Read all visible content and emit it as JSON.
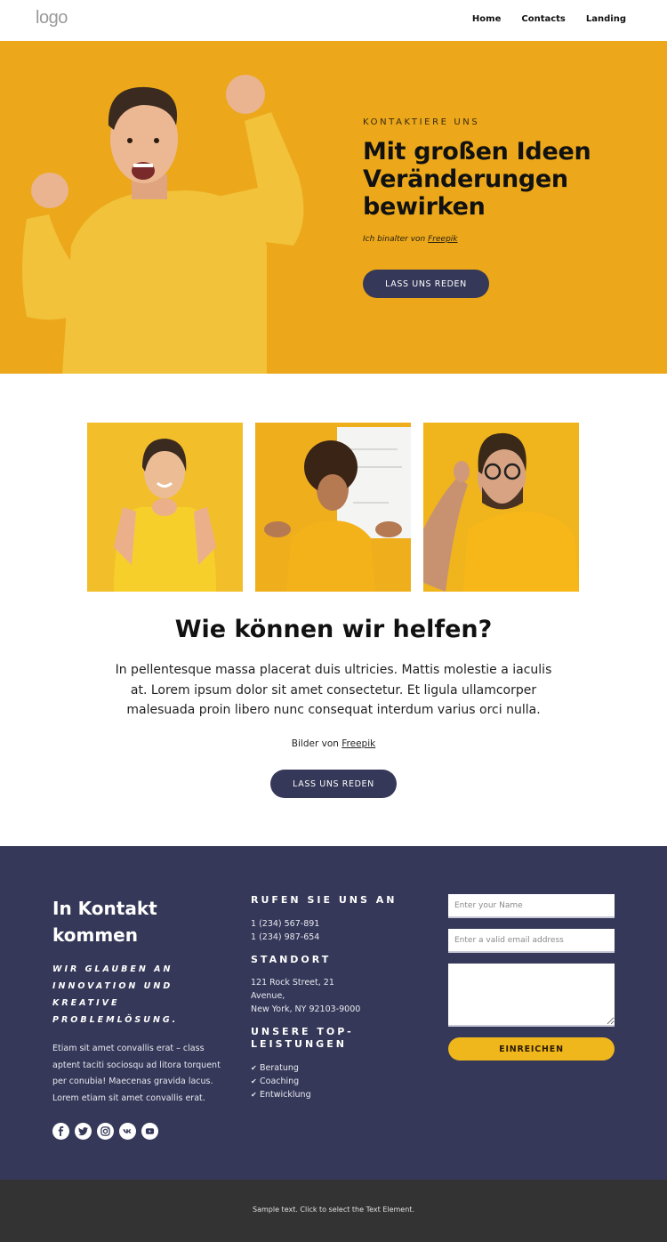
{
  "header": {
    "logo": "logo",
    "nav": [
      {
        "label": "Home"
      },
      {
        "label": "Contacts"
      },
      {
        "label": "Landing"
      }
    ]
  },
  "hero": {
    "kicker": "KONTAKTIERE UNS",
    "title": "Mit großen Ideen Veränderungen bewirken",
    "credit_prefix": "Ich binalter von ",
    "credit_link": "Freepik",
    "button": "LASS UNS REDEN",
    "image": "excited-man-yellow-sweater",
    "colors": {
      "background": "#eca81a",
      "button": "#353858"
    }
  },
  "gallery": {
    "images": [
      {
        "alt": "smiling-woman-yellow-tshirt"
      },
      {
        "alt": "woman-shrugging-yellow-shirt"
      },
      {
        "alt": "surprised-man-glasses"
      }
    ]
  },
  "help": {
    "title": "Wie können wir helfen?",
    "body": "In pellentesque massa placerat duis ultricies. Mattis molestie a iaculis at. Lorem ipsum dolor sit amet consectetur. Et ligula ullamcorper malesuada proin libero nunc consequat interdum varius orci nulla.",
    "credit_prefix": "Bilder von ",
    "credit_link": "Freepik",
    "button": "LASS UNS REDEN"
  },
  "contact": {
    "title": "In Kontakt kommen",
    "tagline": "WIR GLAUBEN AN INNOVATION UND KREATIVE PROBLEMLÖSUNG.",
    "body": "Etiam sit amet convallis erat – class aptent taciti sociosqu ad litora torquent per conubia! Maecenas gravida lacus. Lorem etiam sit amet convallis erat.",
    "socials": [
      {
        "icon": "facebook-icon"
      },
      {
        "icon": "twitter-icon"
      },
      {
        "icon": "instagram-icon"
      },
      {
        "icon": "vk-icon"
      },
      {
        "icon": "youtube-icon"
      }
    ],
    "call_heading": "RUFEN SIE UNS AN",
    "phones": [
      "1 (234) 567-891",
      "1 (234) 987-654"
    ],
    "location_heading": "STANDORT",
    "address": [
      "121 Rock Street, 21",
      "Avenue,",
      "New York, NY 92103-9000"
    ],
    "services_heading": "UNSERE TOP-LEISTUNGEN",
    "services": [
      "Beratung",
      "Coaching",
      "Entwicklung"
    ],
    "form": {
      "name_placeholder": "Enter your Name",
      "email_placeholder": "Enter a valid email address",
      "message_value": "",
      "submit": "EINREICHEN"
    },
    "colors": {
      "background": "#353858",
      "submit": "#f0b71c"
    }
  },
  "footer": {
    "text": "Sample text. Click to select the Text Element."
  }
}
